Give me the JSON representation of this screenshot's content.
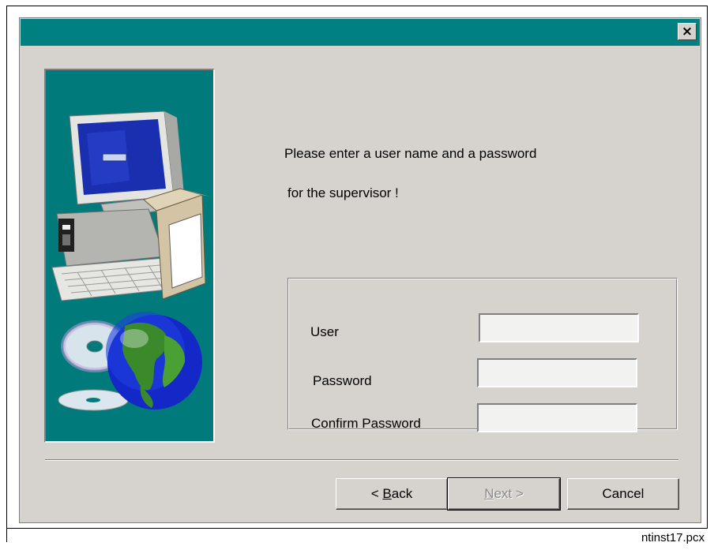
{
  "dialog": {
    "close_label": "×"
  },
  "message": {
    "line1": "Please enter a user name and a password",
    "line2": "for the supervisor !"
  },
  "form": {
    "user_label": "User",
    "user_value": "",
    "password_label": "Password",
    "password_value": "",
    "confirm_label": "Confirm Password",
    "confirm_value": ""
  },
  "buttons": {
    "back": {
      "prefix": "< ",
      "hotkey": "B",
      "rest": "ack"
    },
    "next": {
      "hotkey": "N",
      "rest": "ext >",
      "enabled": false
    },
    "cancel": "Cancel"
  },
  "caption": "ntinst17.pcx",
  "colors": {
    "titlebar": "#008080",
    "dialog_bg": "#d6d3ce",
    "side_panel": "#007a7a"
  },
  "icons": [
    "computer-illustration",
    "cd-discs",
    "globe"
  ]
}
